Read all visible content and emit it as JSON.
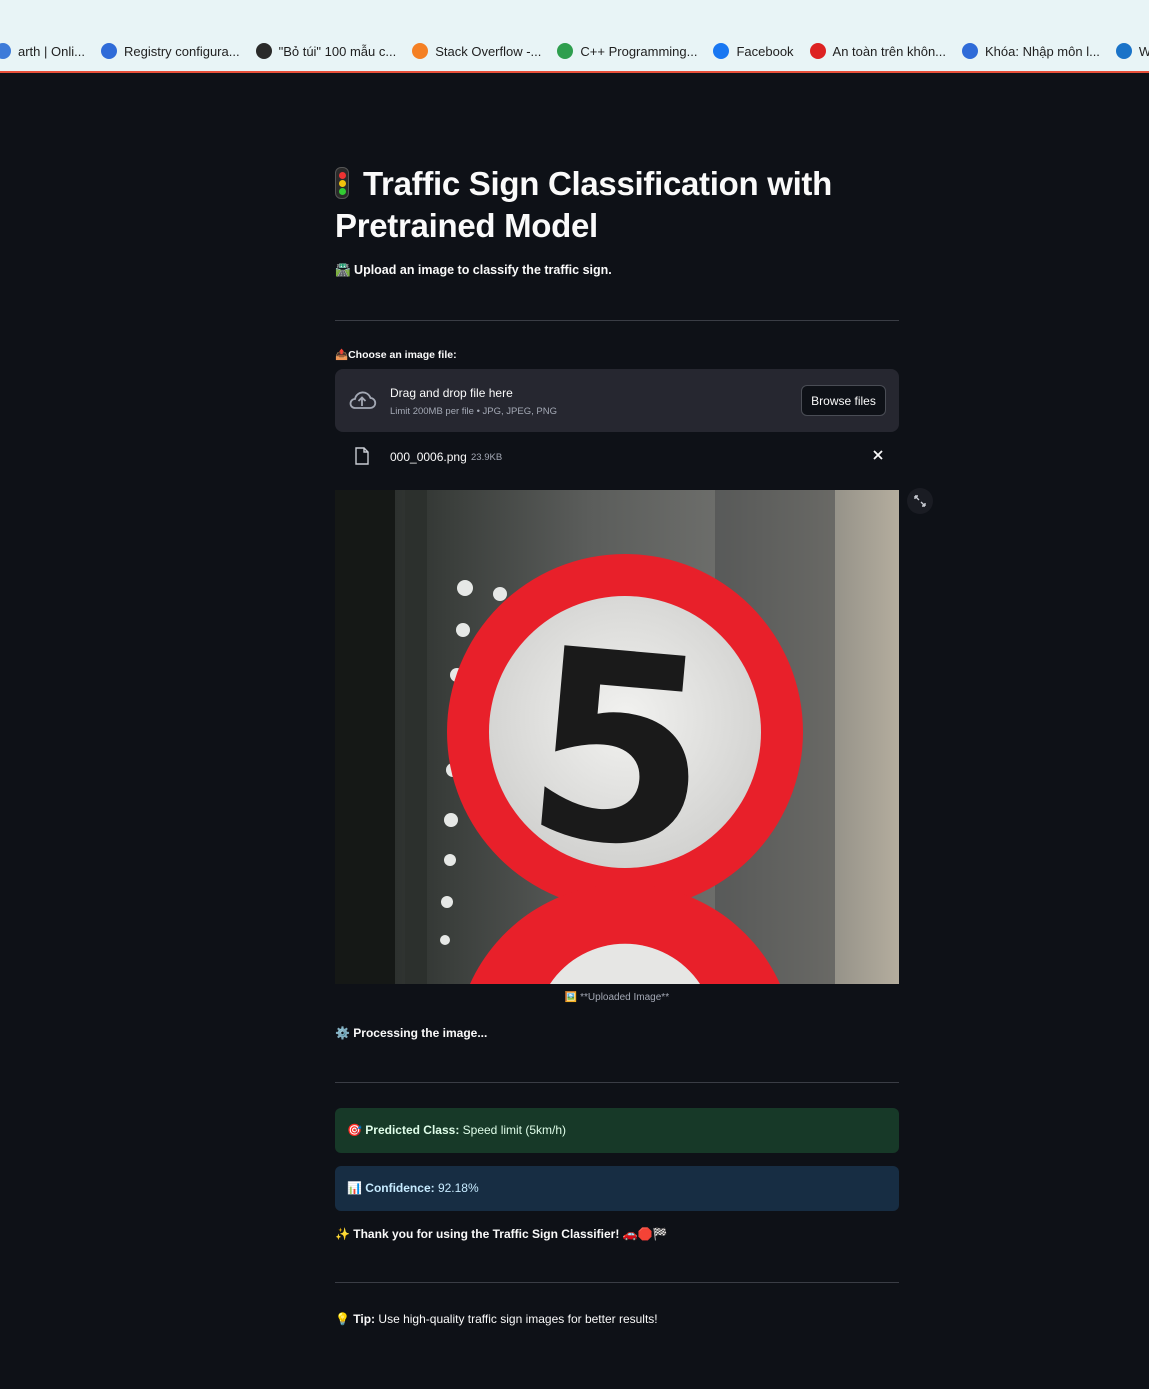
{
  "bookmarks": [
    {
      "label": "arth | Onli...",
      "icon": "earth-icon",
      "color": "#3d7bd9"
    },
    {
      "label": "Registry configura...",
      "icon": "edge-icon",
      "color": "#2f6bd8"
    },
    {
      "label": "\"Bỏ túi\" 100 mẫu c...",
      "icon": "ninja-icon",
      "color": "#2a2a2a"
    },
    {
      "label": "Stack Overflow -...",
      "icon": "stackoverflow-icon",
      "color": "#f48024"
    },
    {
      "label": "C++ Programming...",
      "icon": "infinity-icon",
      "color": "#2e9e4e"
    },
    {
      "label": "Facebook",
      "icon": "facebook-icon",
      "color": "#1877f2"
    },
    {
      "label": "An toàn trên khôn...",
      "icon": "star-badge-icon",
      "color": "#d22"
    },
    {
      "label": "Khóa: Nhập môn l...",
      "icon": "edge-icon",
      "color": "#2f6bd8"
    },
    {
      "label": "Weco",
      "icon": "globe-icon",
      "color": "#1a73c8"
    }
  ],
  "app": {
    "title": "Traffic Sign Classification with Pretrained Model",
    "title_icon": "traffic-light-icon",
    "subtitle": "🛣️ Upload an image to classify the traffic sign.",
    "uploader_label": "📤Choose an image file:",
    "dropzone_text": "Drag and drop file here",
    "dropzone_limit": "Limit 200MB per file • JPG, JPEG, PNG",
    "browse_label": "Browse files",
    "file_name": "000_0006.png",
    "file_size": "23.9KB",
    "image_caption": "🖼️ **Uploaded Image**",
    "sign_digit": "5",
    "processing": "⚙️ Processing the image...",
    "predicted_label": "🎯 Predicted Class:",
    "predicted_value": "Speed limit (5km/h)",
    "confidence_label": "📊 Confidence:",
    "confidence_value": "92.18%",
    "thanks": "✨ Thank you for using the Traffic Sign Classifier! 🚗🛑🏁",
    "tip_label": "💡 Tip:",
    "tip_text": "Use high-quality traffic sign images for better results!"
  },
  "colors": {
    "background": "#0e1117",
    "success_bg": "#173928",
    "info_bg": "#172d43",
    "sign_red": "#e8202a"
  }
}
